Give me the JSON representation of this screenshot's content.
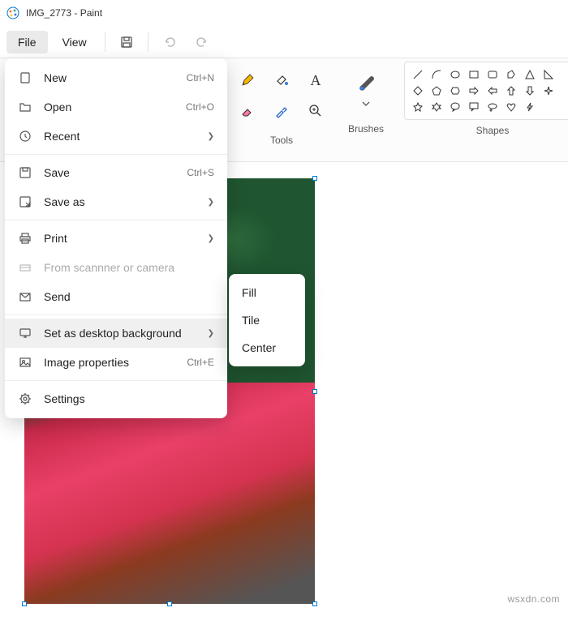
{
  "titlebar": {
    "title": "IMG_2773 - Paint"
  },
  "menubar": {
    "file": "File",
    "view": "View"
  },
  "ribbon": {
    "tools_label": "Tools",
    "brushes_label": "Brushes",
    "shapes_label": "Shapes"
  },
  "file_menu": {
    "new": {
      "label": "New",
      "accel": "Ctrl+N"
    },
    "open": {
      "label": "Open",
      "accel": "Ctrl+O"
    },
    "recent": {
      "label": "Recent"
    },
    "save": {
      "label": "Save",
      "accel": "Ctrl+S"
    },
    "save_as": {
      "label": "Save as"
    },
    "print": {
      "label": "Print"
    },
    "scanner": {
      "label": "From scannner or camera"
    },
    "send": {
      "label": "Send"
    },
    "desktop_bg": {
      "label": "Set as desktop background"
    },
    "image_props": {
      "label": "Image properties",
      "accel": "Ctrl+E"
    },
    "settings": {
      "label": "Settings"
    }
  },
  "submenu": {
    "fill": "Fill",
    "tile": "Tile",
    "center": "Center"
  },
  "watermark": "wsxdn.com"
}
